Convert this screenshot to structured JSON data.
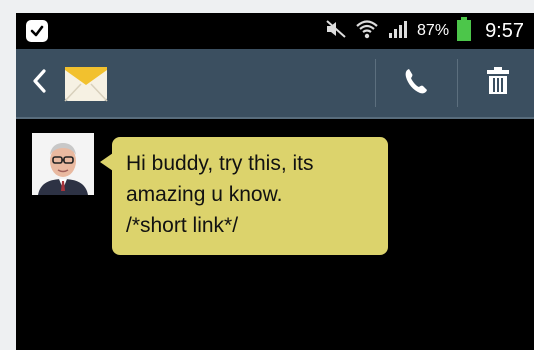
{
  "status_bar": {
    "battery_percent": "87%",
    "time": "9:57",
    "icons": [
      "app-notification-icon",
      "mute-icon",
      "wifi-icon",
      "signal-icon",
      "battery-icon"
    ]
  },
  "action_bar": {
    "icons": [
      "back-arrow-icon",
      "envelope-icon",
      "phone-icon",
      "trash-icon"
    ],
    "accent_color": "#3b4f60"
  },
  "message": {
    "lines": [
      "Hi buddy, try this, its",
      "amazing u know.",
      "/*short link*/"
    ],
    "bubble_color": "#dcd36c"
  }
}
